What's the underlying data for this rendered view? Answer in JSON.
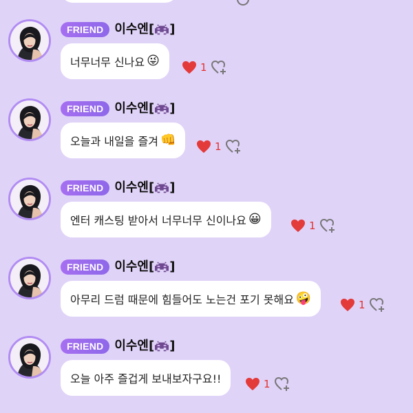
{
  "colors": {
    "background": "#e0d3f8",
    "badge": "#9b6bef",
    "bubble": "#ffffff",
    "heart": "#e33a3a",
    "avatar_border": "#b18cf3"
  },
  "icons": {
    "avatar": "profile-photo-icon",
    "badge_suffix": "space-invader-icon",
    "like": "heart-icon",
    "reaction": "add-reaction-heart-icon"
  },
  "messages": [
    {
      "badge": "FRIEND",
      "username": "이수엔",
      "text": "너무너무 신나요",
      "emoji": "😜",
      "likes": "1"
    },
    {
      "badge": "FRIEND",
      "username": "이수엔",
      "text": "오늘과 내일을 즐겨",
      "emoji": "👊",
      "likes": "1"
    },
    {
      "badge": "FRIEND",
      "username": "이수엔",
      "text": "엔터 캐스팅 받아서 너무너무 신이나요",
      "emoji": "😀",
      "likes": "1"
    },
    {
      "badge": "FRIEND",
      "username": "이수엔",
      "text": "아무리 드럼 때문에 힘들어도 노는건 포기 못해요",
      "emoji": "🤪",
      "likes": "1"
    },
    {
      "badge": "FRIEND",
      "username": "이수엔",
      "text": "오늘 아주 즐겁게 보내보자구요!!",
      "emoji": "",
      "likes": "1"
    }
  ]
}
